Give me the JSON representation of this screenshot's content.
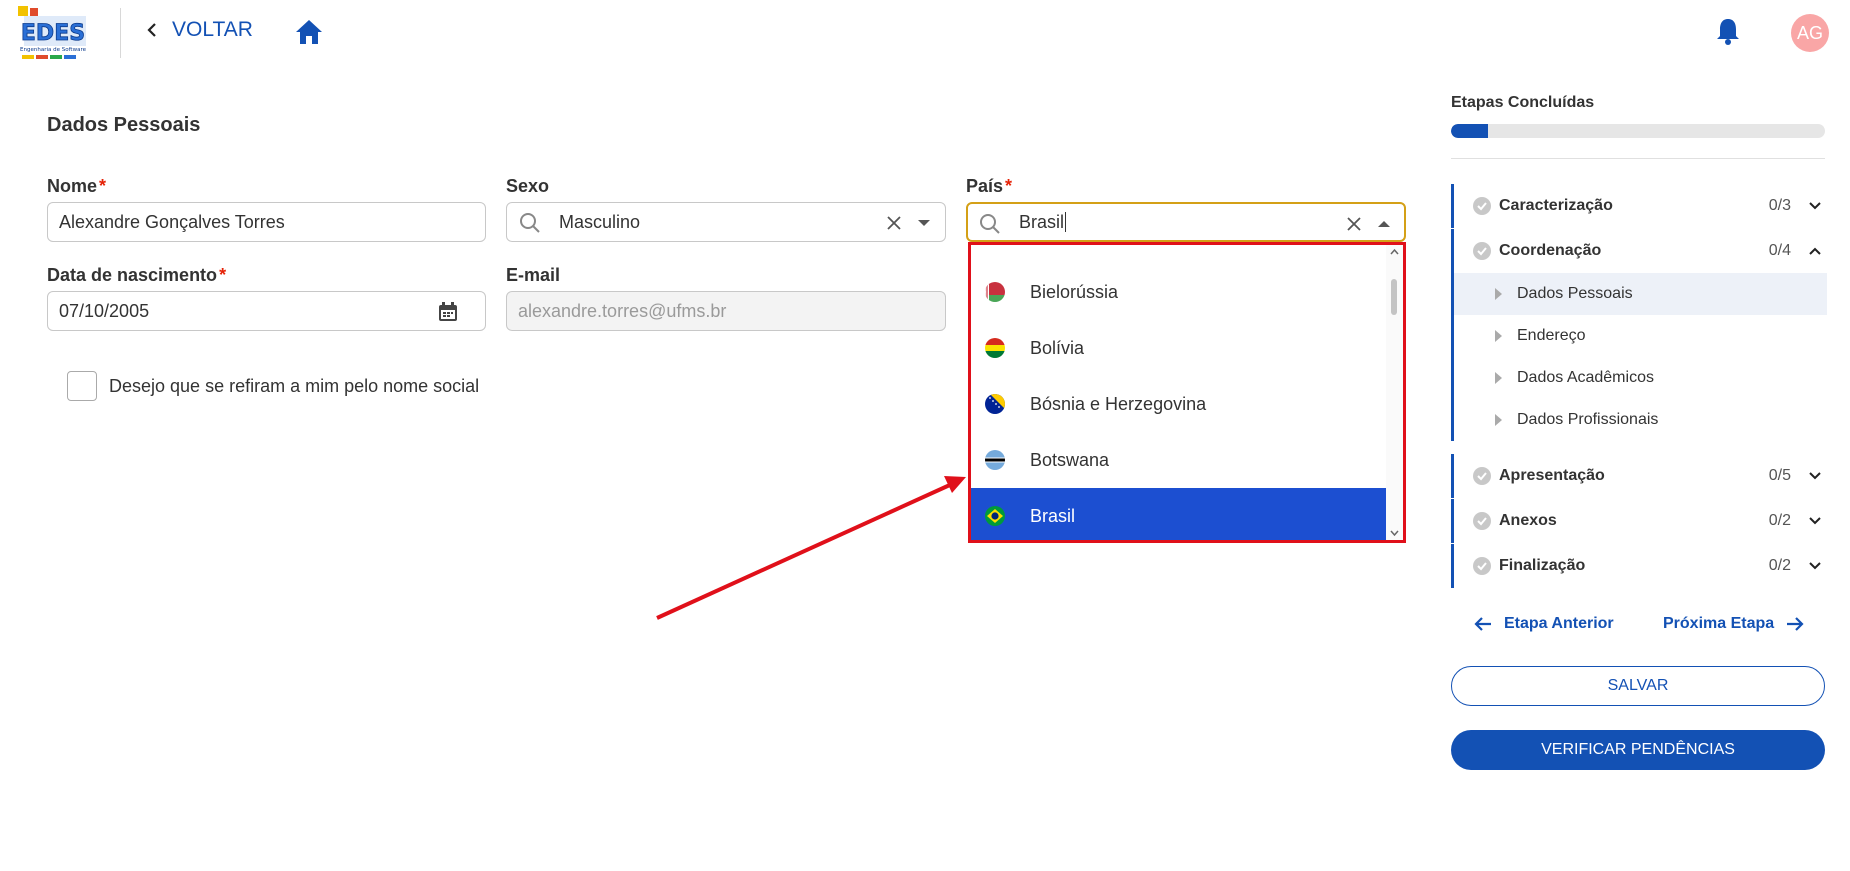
{
  "header": {
    "logo_alt": "EDES Engenharia de Software",
    "back_label": "VOLTAR",
    "avatar_initials": "AG"
  },
  "form": {
    "section_title": "Dados Pessoais",
    "nome": {
      "label": "Nome",
      "required_mark": "*",
      "value": "Alexandre Gonçalves Torres"
    },
    "sexo": {
      "label": "Sexo",
      "value": "Masculino"
    },
    "pais": {
      "label": "País",
      "required_mark": "*",
      "value": "Brasil"
    },
    "nascimento": {
      "label": "Data de nascimento",
      "required_mark": "*",
      "value": "07/10/2005"
    },
    "email": {
      "label": "E-mail",
      "value": "alexandre.torres@ufms.br"
    },
    "nome_social_checkbox": {
      "label": "Desejo que se refiram a mim pelo nome social",
      "checked": false
    }
  },
  "country_dropdown": {
    "options": [
      {
        "label": "Bielorússia",
        "icon": "belarus-flag-icon"
      },
      {
        "label": "Bolívia",
        "icon": "bolivia-flag-icon"
      },
      {
        "label": "Bósnia e Herzegovina",
        "icon": "bosnia-flag-icon"
      },
      {
        "label": "Botswana",
        "icon": "botswana-flag-icon"
      },
      {
        "label": "Brasil",
        "icon": "brazil-flag-icon",
        "selected": true
      }
    ]
  },
  "sidebar": {
    "title": "Etapas Concluídas",
    "progress_fraction": 0.1,
    "stages": [
      {
        "name": "Caracterização",
        "count": "0/3",
        "expanded": false
      },
      {
        "name": "Coordenação",
        "count": "0/4",
        "expanded": true,
        "substages": [
          "Dados Pessoais",
          "Endereço",
          "Dados Acadêmicos",
          "Dados Profissionais"
        ]
      },
      {
        "name": "Apresentação",
        "count": "0/5",
        "expanded": false
      },
      {
        "name": "Anexos",
        "count": "0/2",
        "expanded": false
      },
      {
        "name": "Finalização",
        "count": "0/2",
        "expanded": false
      }
    ],
    "prev_label": "Etapa Anterior",
    "next_label": "Próxima Etapa",
    "save_label": "SALVAR",
    "verify_label": "VERIFICAR PENDÊNCIAS"
  },
  "colors": {
    "primary": "#1351b4",
    "selected_option": "#1c4fd1",
    "highlight_border": "#e0101a",
    "required": "#e52207",
    "focus_border": "#d4a017"
  }
}
